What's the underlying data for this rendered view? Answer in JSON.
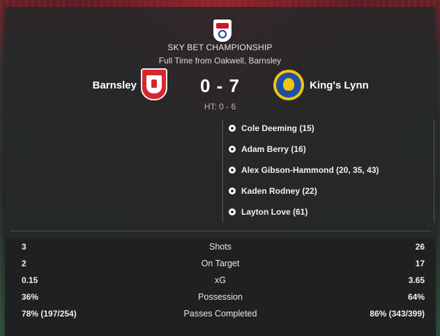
{
  "match": {
    "competition": "SKY BET CHAMPIONSHIP",
    "venue": "Full Time from Oakwell, Barnsley",
    "home_team": "Barnsley",
    "away_team": "King's Lynn",
    "score": "0 - 7",
    "half_time": "HT: 0 - 6"
  },
  "scorers": [
    {
      "text": "Cole Deeming (15)"
    },
    {
      "text": "Adam Berry (16)"
    },
    {
      "text": "Alex Gibson-Hammond (20, 35, 43)"
    },
    {
      "text": "Kaden Rodney (22)"
    },
    {
      "text": "Layton Love (61)"
    }
  ],
  "stats": [
    {
      "home": "3",
      "label": "Shots",
      "away": "26"
    },
    {
      "home": "2",
      "label": "On Target",
      "away": "17"
    },
    {
      "home": "0.15",
      "label": "xG",
      "away": "3.65"
    },
    {
      "home": "36%",
      "label": "Possession",
      "away": "64%"
    },
    {
      "home": "78% (197/254)",
      "label": "Passes Completed",
      "away": "86% (343/399)"
    }
  ],
  "icons": {
    "competition": "sky-bet-championship-logo",
    "home_crest": "barnsley-crest",
    "away_crest": "kings-lynn-crest",
    "goal": "football-icon"
  },
  "colors": {
    "home_primary": "#d9262e",
    "away_primary": "#1f4fa5",
    "away_secondary": "#f1c40f"
  }
}
